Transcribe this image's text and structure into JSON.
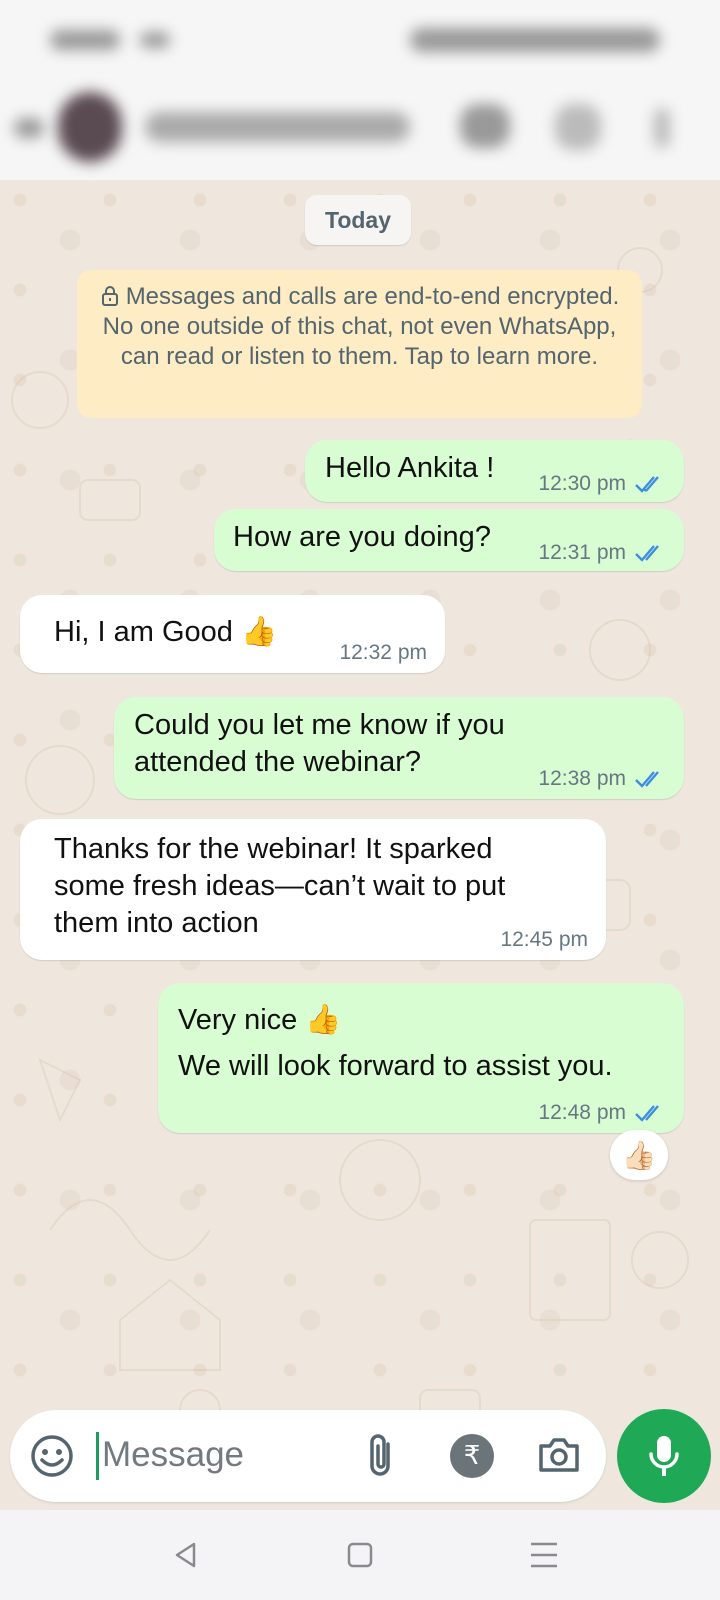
{
  "date_divider": "Today",
  "encryption_notice": "Messages and calls are end-to-end encrypted. No one outside of this chat, not even WhatsApp, can read or listen to them. Tap to learn more.",
  "messages": [
    {
      "direction": "outgoing",
      "text": "Hello Ankita !",
      "time": "12:30 pm",
      "status": "read"
    },
    {
      "direction": "outgoing",
      "text": "How are you doing?",
      "time": "12:31 pm",
      "status": "read"
    },
    {
      "direction": "incoming",
      "text": "Hi, I am Good 👍",
      "time": "12:32 pm"
    },
    {
      "direction": "outgoing",
      "text": "Could you let me know if you\nattended the webinar?",
      "time": "12:38 pm",
      "status": "read"
    },
    {
      "direction": "incoming",
      "text": "Thanks for the webinar! It sparked\nsome fresh ideas—can’t wait to put\nthem into action",
      "time": "12:45 pm"
    },
    {
      "direction": "outgoing",
      "text": "Very nice 👍\nWe will look forward to assist you.",
      "time": "12:48 pm",
      "status": "read",
      "reaction": "👍🏻"
    }
  ],
  "composer": {
    "placeholder": "Message",
    "value": ""
  },
  "icons": {
    "emoji": "emoji-icon",
    "attach": "paperclip-icon",
    "payment": "rupee-icon",
    "camera": "camera-icon",
    "mic": "mic-icon",
    "lock": "lock-icon",
    "read_receipt": "double-check-icon"
  },
  "colors": {
    "outgoing_bubble": "#d9fdd3",
    "incoming_bubble": "#ffffff",
    "read_tick": "#3d8ee3",
    "accent": "#1fa855"
  }
}
